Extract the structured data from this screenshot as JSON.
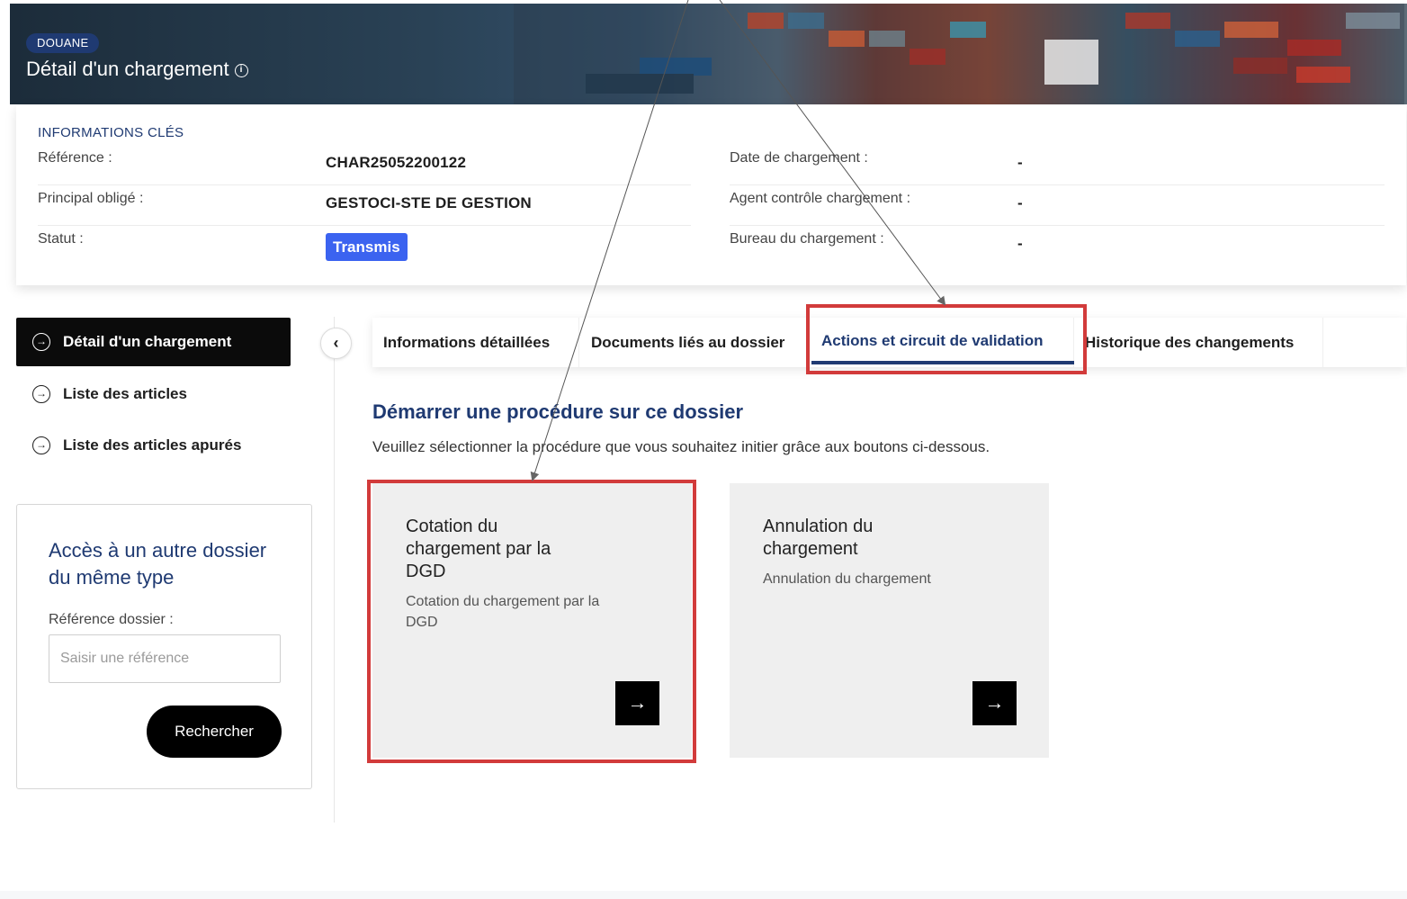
{
  "banner": {
    "badge": "DOUANE",
    "title": "Détail d'un chargement",
    "info_icon_glyph": "i"
  },
  "key_info": {
    "heading": "INFORMATIONS CLÉS",
    "left": [
      {
        "label": "Référence :",
        "value": "CHAR25052200122"
      },
      {
        "label": "Principal obligé :",
        "value": "GESTOCI-STE DE GESTION"
      },
      {
        "label": "Statut :",
        "value": "Transmis"
      }
    ],
    "right": [
      {
        "label": "Date de chargement :",
        "value": "-"
      },
      {
        "label": "Agent contrôle chargement :",
        "value": "-"
      },
      {
        "label": "Bureau du chargement :",
        "value": "-"
      }
    ],
    "status_color": "#3b63f0"
  },
  "sidebar": {
    "items": [
      {
        "label": "Détail d'un chargement",
        "icon": "arrow-circle-right-icon",
        "active": true
      },
      {
        "label": "Liste des articles",
        "icon": "arrow-circle-right-icon",
        "active": false
      },
      {
        "label": "Liste des articles apurés",
        "icon": "arrow-circle-right-icon",
        "active": false
      }
    ],
    "collapse_icon": "chevron-left-icon"
  },
  "search": {
    "title": "Accès à un autre dossier du même type",
    "label": "Référence dossier :",
    "placeholder": "Saisir une référence",
    "button": "Rechercher"
  },
  "tabs": [
    {
      "label": "Informations détaillées",
      "active": false
    },
    {
      "label": "Documents liés au dossier",
      "active": false
    },
    {
      "label": "Actions et circuit de validation",
      "active": true
    },
    {
      "label": "Historique des changements",
      "active": false
    }
  ],
  "main": {
    "title": "Démarrer une procédure sur ce dossier",
    "description": "Veuillez sélectionner la procédure que vous souhaitez initier grâce aux boutons ci-dessous.",
    "procedures": [
      {
        "title": "Cotation du chargement par la DGD",
        "subtitle": "Cotation du chargement par la DGD",
        "arrow": "→"
      },
      {
        "title": "Annulation du chargement",
        "subtitle": "Annulation du chargement",
        "arrow": "→"
      }
    ]
  },
  "colors": {
    "accent": "#1f3a72",
    "highlight": "#d23b3b",
    "active_nav": "#0b0b0b"
  }
}
